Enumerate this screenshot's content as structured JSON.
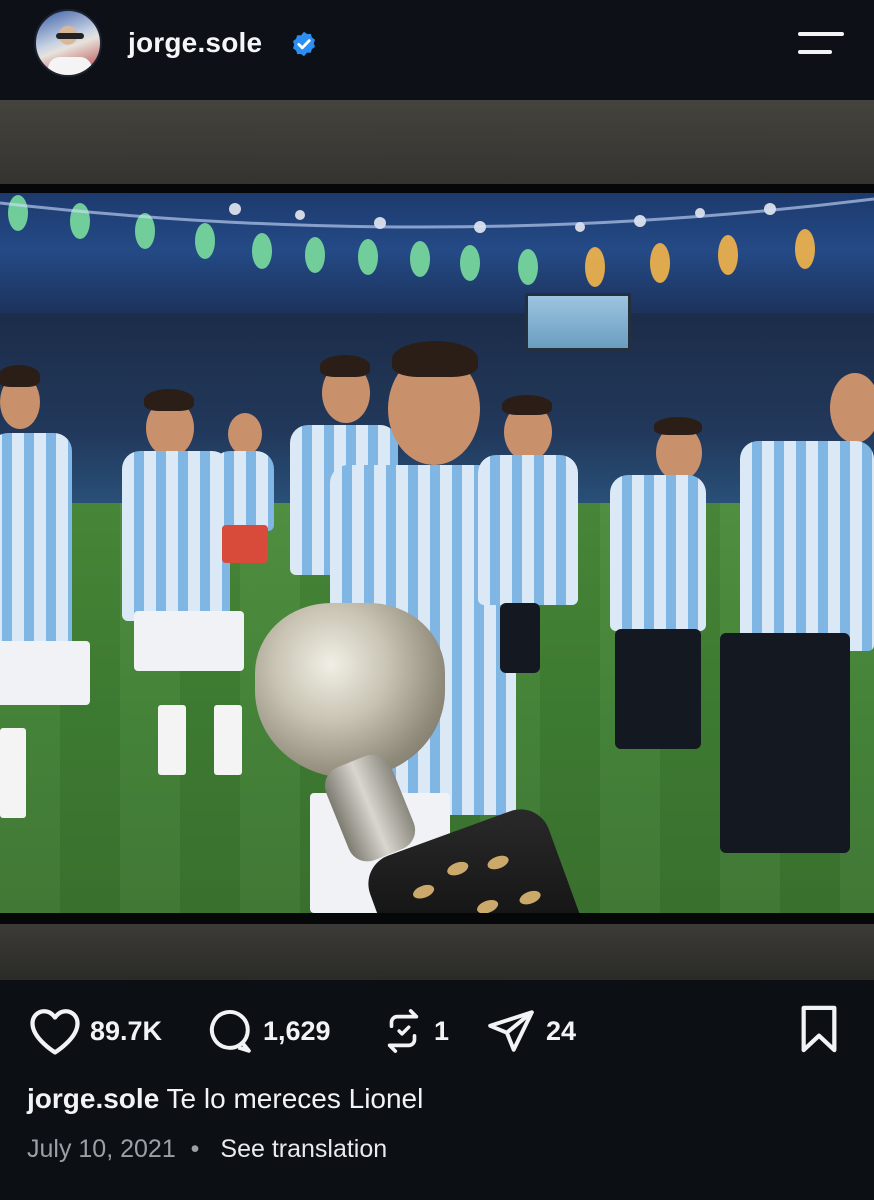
{
  "header": {
    "username": "jorge.sole",
    "verified": true,
    "icons": {
      "avatar": "profile-avatar",
      "verified": "verified-badge-icon",
      "menu": "menu-icon"
    }
  },
  "post": {
    "image_description_icon": "photo-of-tv-screen",
    "actions": {
      "likes": "89.7K",
      "comments": "1,629",
      "reposts": "1",
      "shares": "24"
    },
    "caption": {
      "username": "jorge.sole",
      "text": "Te lo mereces Lionel"
    },
    "date": "July 10, 2021",
    "separator": "•",
    "see_translation": "See translation"
  },
  "colors": {
    "background": "#0c0f14",
    "verified_blue": "#2b8ef0",
    "meta_gray": "#9aa0a8"
  }
}
